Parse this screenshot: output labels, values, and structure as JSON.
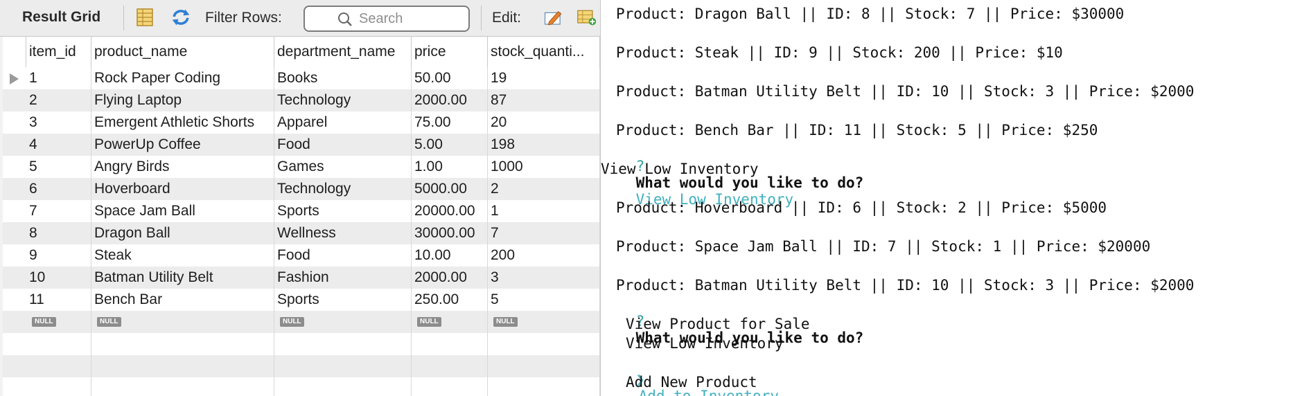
{
  "toolbar": {
    "title": "Result Grid",
    "filter_label": "Filter Rows:",
    "search_placeholder": "Search",
    "edit_label": "Edit:"
  },
  "grid": {
    "columns": [
      "item_id",
      "product_name",
      "department_name",
      "price",
      "stock_quanti..."
    ],
    "rows": [
      [
        "1",
        "Rock Paper Coding",
        "Books",
        "50.00",
        "19"
      ],
      [
        "2",
        "Flying Laptop",
        "Technology",
        "2000.00",
        "87"
      ],
      [
        "3",
        "Emergent Athletic Shorts",
        "Apparel",
        "75.00",
        "20"
      ],
      [
        "4",
        "PowerUp Coffee",
        "Food",
        "5.00",
        "198"
      ],
      [
        "5",
        "Angry Birds",
        "Games",
        "1.00",
        "1000"
      ],
      [
        "6",
        "Hoverboard",
        "Technology",
        "5000.00",
        "2"
      ],
      [
        "7",
        "Space Jam Ball",
        "Sports",
        "20000.00",
        "1"
      ],
      [
        "8",
        "Dragon Ball",
        "Wellness",
        "30000.00",
        "7"
      ],
      [
        "9",
        "Steak",
        "Food",
        "10.00",
        "200"
      ],
      [
        "10",
        "Batman Utility Belt",
        "Fashion",
        "2000.00",
        "3"
      ],
      [
        "11",
        "Bench Bar",
        "Sports",
        "250.00",
        "5"
      ]
    ],
    "null_label": "NULL"
  },
  "terminal": {
    "lines": [
      {
        "kind": "product",
        "text": "Product: Dragon Ball || ID: 8 || Stock: 7 || Price: $30000"
      },
      {
        "kind": "product",
        "text": "Product: Steak || ID: 9 || Stock: 200 || Price: $10"
      },
      {
        "kind": "product",
        "text": "Product: Batman Utility Belt || ID: 10 || Stock: 3 || Price: $2000"
      },
      {
        "kind": "product",
        "text": "Product: Bench Bar || ID: 11 || Stock: 5 || Price: $250"
      }
    ],
    "prompt1": {
      "mark": "?",
      "question": "What would you like to do?",
      "answer": "View Low Inventory"
    },
    "echo": "View Low Inventory",
    "low_lines": [
      "Product: Hoverboard || ID: 6 || Stock: 2 || Price: $5000",
      "Product: Space Jam Ball || ID: 7 || Stock: 1 || Price: $20000",
      "Product: Batman Utility Belt || ID: 10 || Stock: 3 || Price: $2000"
    ],
    "prompt2": {
      "mark": "?",
      "question": "What would you like to do?"
    },
    "menu": {
      "pointer": "❯",
      "options": [
        "View Product for Sale",
        "View Low Inventory",
        "Add to Inventory",
        "Add New Product"
      ],
      "selected_index": 2
    }
  },
  "colors": {
    "accent": "#42b0c0",
    "null_badge": "#8c8c8c"
  }
}
